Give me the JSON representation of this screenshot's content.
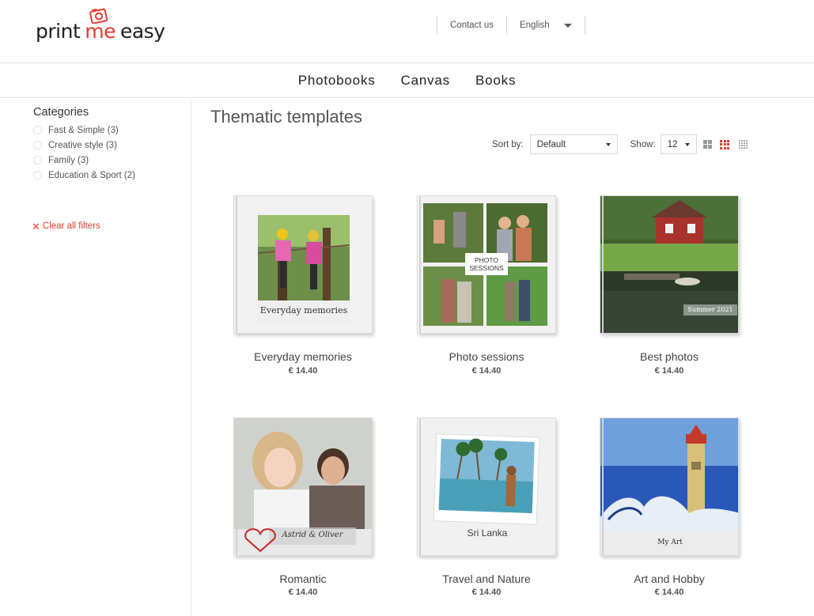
{
  "header": {
    "logo": {
      "part1": "print",
      "part2": "me",
      "part3": "easy"
    },
    "contact_label": "Contact us",
    "language_label": "English"
  },
  "nav": {
    "items": [
      "Photobooks",
      "Canvas",
      "Books"
    ]
  },
  "sidebar": {
    "title": "Categories",
    "categories": [
      "Fast & Simple (3)",
      "Creative style (3)",
      "Family (3)",
      "Education & Sport (2)"
    ],
    "clear_label": "Clear all filters"
  },
  "main": {
    "title": "Thematic templates",
    "sort_label": "Sort by:",
    "sort_value": "Default",
    "show_label": "Show:",
    "show_value": "12",
    "active_view": "grid-3x3",
    "accent_color": "#e03c31"
  },
  "products": [
    {
      "name": "Everyday memories",
      "price": "€ 14.40",
      "cover_caption": "Everyday memories"
    },
    {
      "name": "Photo sessions",
      "price": "€ 14.40",
      "cover_caption": "PHOTO SESSIONS"
    },
    {
      "name": "Best photos",
      "price": "€ 14.40",
      "cover_caption": "Summer 2021"
    },
    {
      "name": "Romantic",
      "price": "€ 14.40",
      "cover_caption": "Astrid & Oliver"
    },
    {
      "name": "Travel and Nature",
      "price": "€ 14.40",
      "cover_caption": "Sri Lanka"
    },
    {
      "name": "Art and Hobby",
      "price": "€ 14.40",
      "cover_caption": "My Art"
    }
  ]
}
